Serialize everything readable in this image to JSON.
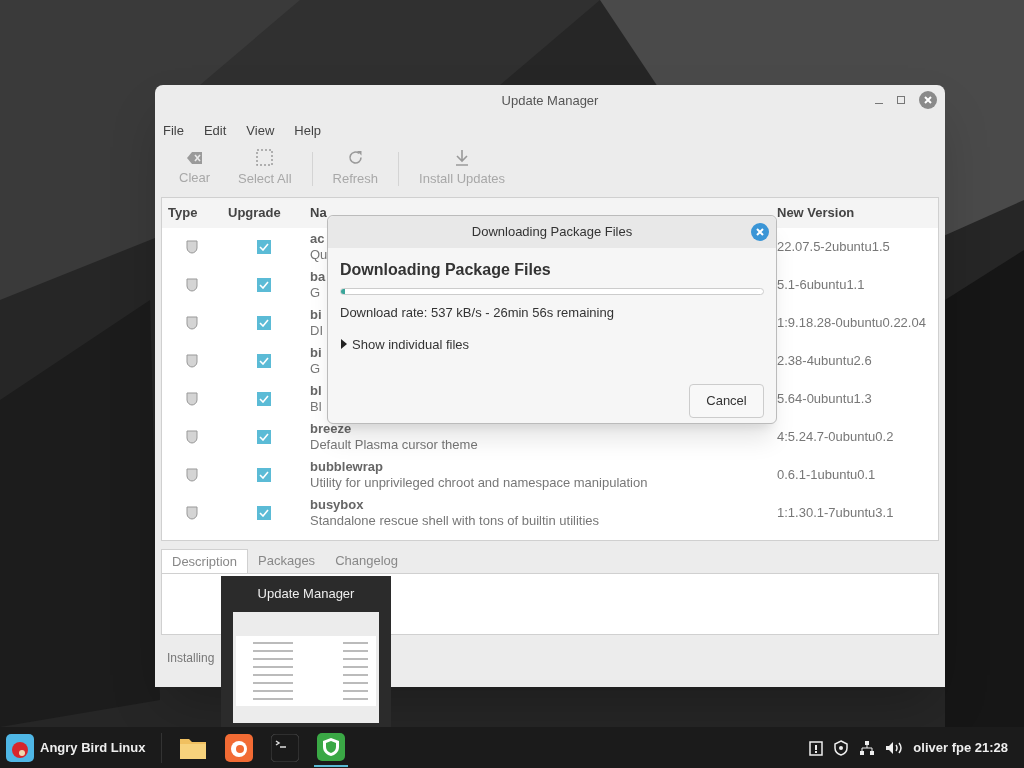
{
  "window": {
    "title": "Update Manager"
  },
  "menu": [
    "File",
    "Edit",
    "View",
    "Help"
  ],
  "toolbar": [
    {
      "kind": "clear",
      "label": "Clear",
      "disabled": true
    },
    {
      "kind": "select",
      "label": "Select All",
      "disabled": true
    },
    {
      "kind": "refresh",
      "label": "Refresh",
      "disabled": true
    },
    {
      "kind": "install",
      "label": "Install Updates",
      "disabled": true
    }
  ],
  "table": {
    "columns": [
      "Type",
      "Upgrade",
      "Na",
      "New Version"
    ],
    "rows": [
      {
        "name": "ac",
        "desc": "Qu",
        "version": "22.07.5-2ubuntu1.5",
        "checked": true
      },
      {
        "name": "ba",
        "desc": "G",
        "version": "5.1-6ubuntu1.1",
        "checked": true
      },
      {
        "name": "bi",
        "desc": "DI",
        "version": "1:9.18.28-0ubuntu0.22.04",
        "checked": true
      },
      {
        "name": "bi",
        "desc": "G",
        "version": "2.38-4ubuntu2.6",
        "checked": true
      },
      {
        "name": "bl",
        "desc": "Bl",
        "version": "5.64-0ubuntu1.3",
        "checked": true
      },
      {
        "name": "breeze",
        "desc": "Default Plasma cursor theme",
        "version": "4:5.24.7-0ubuntu0.2",
        "checked": true
      },
      {
        "name": "bubblewrap",
        "desc": "Utility for unprivileged chroot and namespace manipulation",
        "version": "0.6.1-1ubuntu0.1",
        "checked": true
      },
      {
        "name": "busybox",
        "desc": "Standalone rescue shell with tons of builtin utilities",
        "version": "1:1.30.1-7ubuntu3.1",
        "checked": true
      }
    ]
  },
  "detail_tabs": [
    {
      "label": "Description",
      "selected": true
    },
    {
      "label": "Packages",
      "selected": false
    },
    {
      "label": "Changelog",
      "selected": false
    }
  ],
  "status_bar": "Installing",
  "dialog": {
    "title": "Downloading Package Files",
    "heading": "Downloading Package Files",
    "level": 0.01,
    "rate": "Download rate: 537 kB/s - 26min 56s remaining",
    "expander": "Show individual files",
    "expanded": false,
    "button": "Cancel"
  },
  "preview": {
    "title": "Update Manager"
  },
  "taskbar": {
    "menu_label": "Angry Bird Linux",
    "apps": [
      {
        "kind": "folder",
        "selected": false
      },
      {
        "kind": "firefox",
        "selected": false
      },
      {
        "kind": "terminal",
        "selected": false
      },
      {
        "kind": "shield",
        "selected": true
      }
    ],
    "clock": "oliver fpe 21:28"
  }
}
